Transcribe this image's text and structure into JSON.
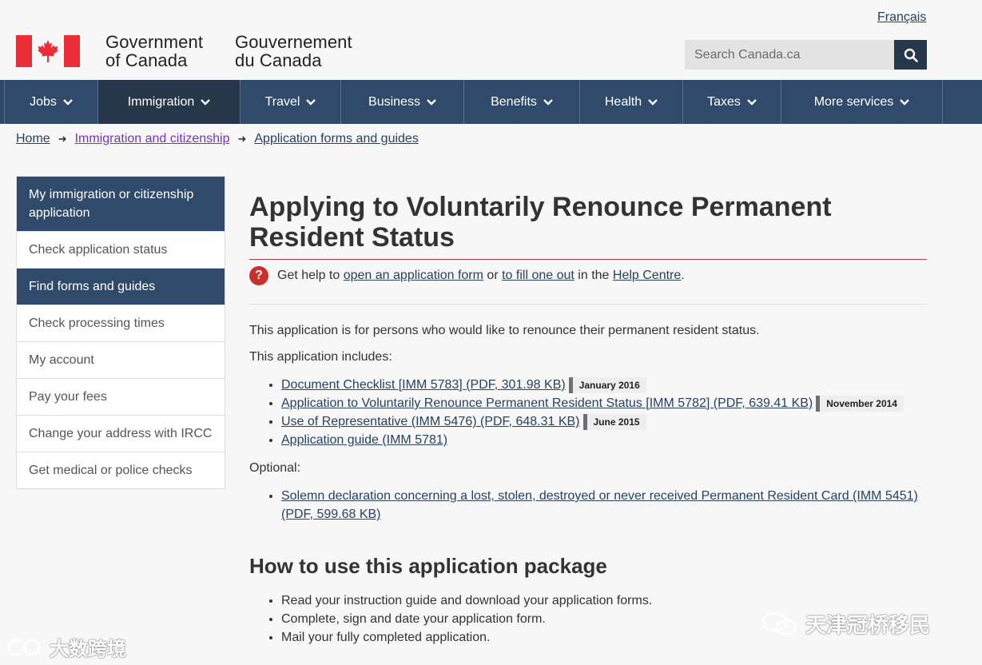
{
  "header": {
    "language_link": "Français",
    "brand_en": [
      "Government",
      "of Canada"
    ],
    "brand_fr": [
      "Gouvernement",
      "du Canada"
    ],
    "search_placeholder": "Search Canada.ca",
    "colors": {
      "nav": "#2f4a6a",
      "nav_active": "#26374a",
      "flag_red": "#eb2d37"
    }
  },
  "menu": [
    {
      "label": "Jobs"
    },
    {
      "label": "Immigration"
    },
    {
      "label": "Travel"
    },
    {
      "label": "Business"
    },
    {
      "label": "Benefits"
    },
    {
      "label": "Health"
    },
    {
      "label": "Taxes"
    },
    {
      "label": "More services"
    }
  ],
  "breadcrumb": [
    "Home",
    "Immigration and citizenship",
    "Application forms and guides"
  ],
  "sidenav": [
    "My immigration or citizenship application",
    "Check application status",
    "Find forms and guides",
    "Check processing times",
    "My account",
    "Pay your fees",
    "Change your address with IRCC",
    "Get medical or police checks"
  ],
  "main": {
    "title": "Applying to Voluntarily Renounce Permanent Resident Status",
    "help": {
      "prefix": "Get help to",
      "link1": "open an application form",
      "mid": "or",
      "link2": "to fill one out",
      "mid2": "in the",
      "link3": "Help Centre",
      "suffix": "."
    },
    "intro": "This application is for persons who would like to renounce their permanent resident status.",
    "includes_label": "This application includes:",
    "documents": [
      {
        "text": "Document Checklist [IMM 5783] (PDF, 301.98 KB)",
        "date": "January 2016"
      },
      {
        "text": "Application to Voluntarily Renounce Permanent Resident Status  [IMM 5782] (PDF, 639.41 KB)",
        "date": "November 2014"
      },
      {
        "text": "Use of Representative (IMM 5476) (PDF, 648.31 KB)",
        "date": "June 2015"
      },
      {
        "text": "Application guide (IMM 5781)",
        "date": ""
      }
    ],
    "optional_label": "Optional:",
    "optional_docs": [
      {
        "text": "Solemn declaration concerning a lost, stolen, destroyed or never received Permanent Resident Card (IMM 5451) (PDF, 599.68 KB)"
      }
    ],
    "how_title": "How to use this application package",
    "steps": [
      "Read your instruction guide and download your application forms.",
      "Complete, sign and date your application form.",
      "Mail your fully completed application."
    ]
  },
  "watermarks": {
    "right": "天津冠桥移民",
    "left": "大数跨境"
  }
}
